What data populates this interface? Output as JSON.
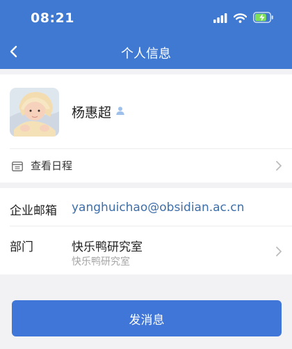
{
  "status_bar": {
    "time": "08:21",
    "icons": [
      "signal-icon",
      "wifi-icon",
      "battery-charging-icon"
    ],
    "battery_color": "#7ee05a"
  },
  "nav": {
    "title": "个人信息",
    "back_icon": "back-chevron-icon"
  },
  "profile": {
    "name": "杨惠超",
    "badge_icon": "user-badge-icon",
    "schedule_label": "查看日程"
  },
  "info": {
    "email_label": "企业邮箱",
    "email_value": "yanghuichao@obsidian.ac.cn",
    "dept_label": "部门",
    "dept_value": "快乐鸭研究室",
    "dept_sub": "快乐鸭研究室"
  },
  "actions": {
    "send_label": "发消息"
  },
  "colors": {
    "header_bg": "#3f79d2",
    "button_bg": "#4076d8",
    "email_text": "#3d6ea8"
  }
}
